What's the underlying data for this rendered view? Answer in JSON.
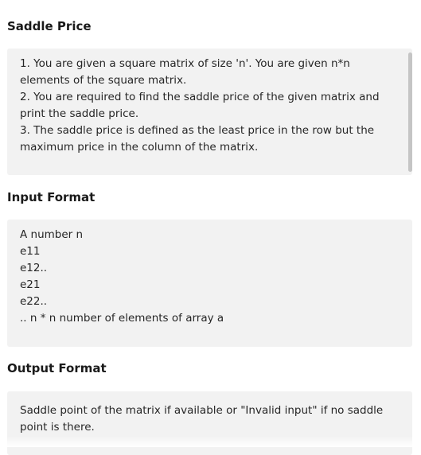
{
  "sections": {
    "saddle": {
      "title": "Saddle Price",
      "lines": [
        "1. You are given a square matrix of size 'n'. You are given n*n",
        "elements of the square matrix.",
        "2. You are required to find the saddle price of the given matrix and",
        "print the saddle price.",
        "3. The saddle price is defined as the least price in the row but the",
        "maximum price in the column of the matrix."
      ]
    },
    "input": {
      "title": "Input Format",
      "lines": [
        "A number n",
        "e11",
        "e12..",
        "e21",
        "e22..",
        ".. n * n number of elements of array a"
      ]
    },
    "output": {
      "title": "Output Format",
      "lines": [
        "Saddle point of the matrix if available or \"Invalid input\" if no saddle",
        "point is there."
      ]
    }
  }
}
